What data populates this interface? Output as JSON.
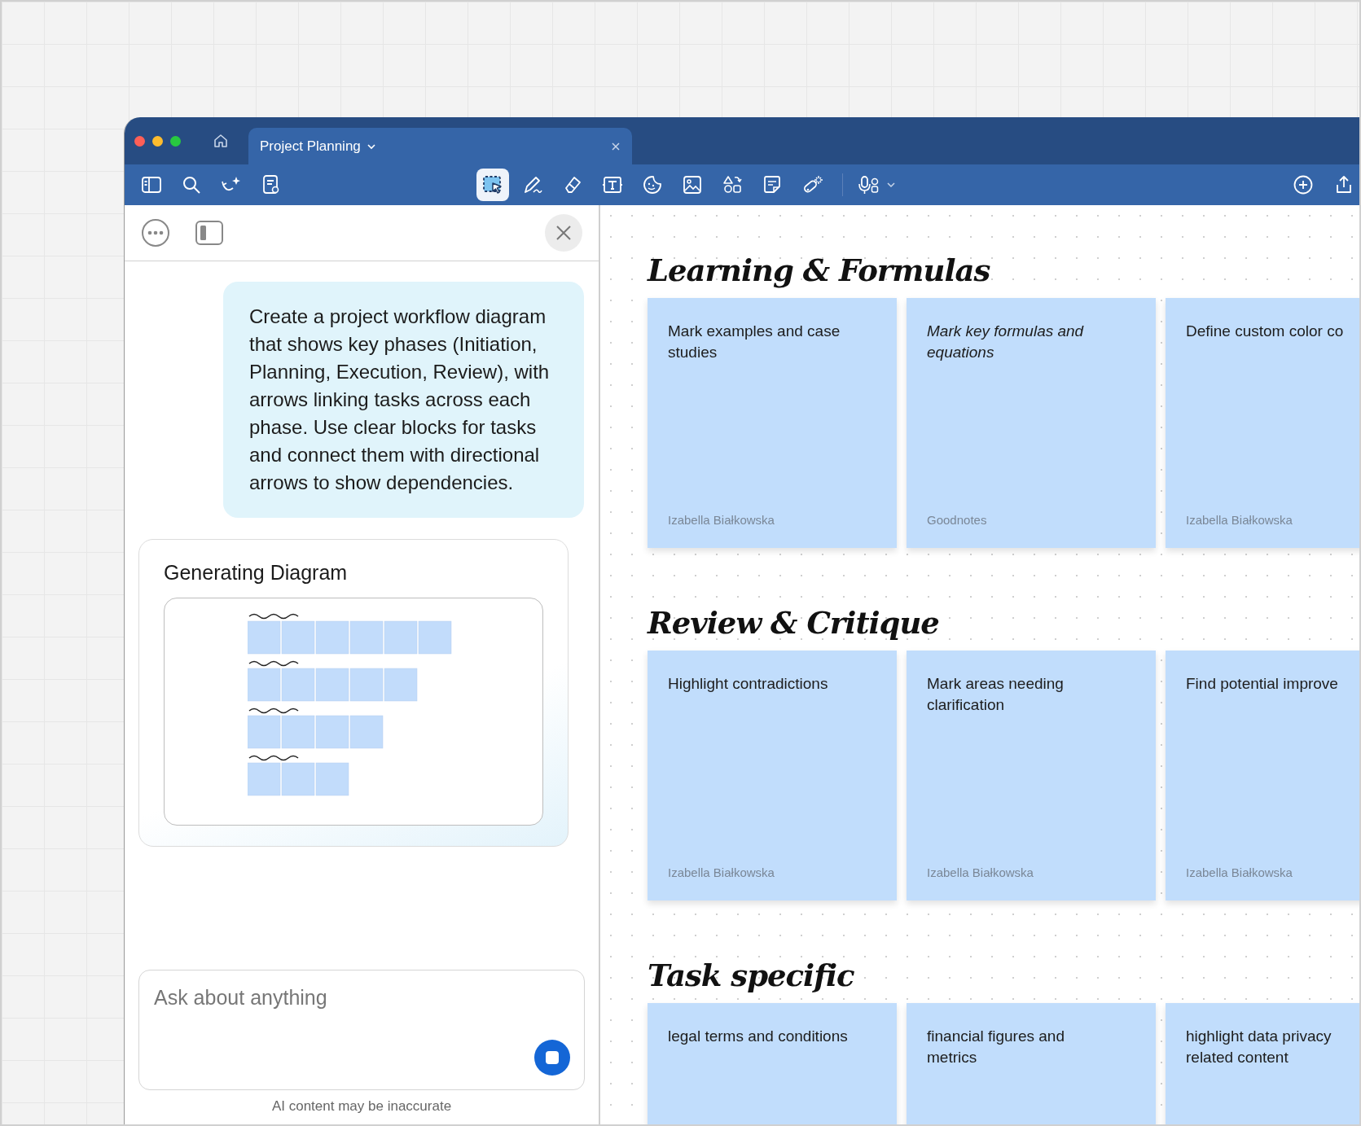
{
  "tab": {
    "title": "Project Planning"
  },
  "toolbar": {
    "left_tools": [
      {
        "kind": "sidebar"
      },
      {
        "kind": "search"
      },
      {
        "kind": "ai"
      },
      {
        "kind": "doc"
      }
    ],
    "tools": [
      {
        "kind": "select",
        "selected": true
      },
      {
        "kind": "pen",
        "selected": false
      },
      {
        "kind": "eraser",
        "selected": false
      },
      {
        "kind": "text",
        "selected": false
      },
      {
        "kind": "sticker",
        "selected": false
      },
      {
        "kind": "image",
        "selected": false
      },
      {
        "kind": "shapes",
        "selected": false
      },
      {
        "kind": "note",
        "selected": false
      },
      {
        "kind": "laser",
        "selected": false
      },
      {
        "kind": "mic",
        "selected": false
      }
    ],
    "right_tools": [
      {
        "kind": "add"
      },
      {
        "kind": "share"
      }
    ]
  },
  "assistant": {
    "message": "Create a project workflow diagram that shows key phases (Initiation, Planning, Execution, Review), with arrows linking tasks across each phase. Use clear blocks for tasks and connect them with directional arrows to show dependencies.",
    "card_title": "Generating Diagram",
    "input": {
      "placeholder": "Ask about anything"
    },
    "disclaimer": "AI content may be inaccurate"
  },
  "canvas": {
    "sections": [
      {
        "heading": "Learning & Formulas",
        "notes": [
          {
            "text": "Mark examples and case studies",
            "author": "Izabella Białkowska",
            "italic": false
          },
          {
            "text": "Mark key formulas and equations",
            "author": "Goodnotes",
            "italic": true
          },
          {
            "text": "Define custom color co",
            "author": "Izabella Białkowska",
            "italic": false
          }
        ]
      },
      {
        "heading": "Review & Critique",
        "notes": [
          {
            "text": "Highlight contradictions",
            "author": "Izabella Białkowska",
            "italic": false
          },
          {
            "text": "Mark areas needing clarification",
            "author": "Izabella Białkowska",
            "italic": false
          },
          {
            "text": "Find potential improve",
            "author": "Izabella Białkowska",
            "italic": false
          }
        ]
      },
      {
        "heading": "Task specific",
        "notes": [
          {
            "text": "legal terms and conditions",
            "italic": false
          },
          {
            "text": "financial figures and metrics",
            "italic": false
          },
          {
            "text": "highlight data privacy related content",
            "italic": false
          }
        ]
      }
    ]
  }
}
